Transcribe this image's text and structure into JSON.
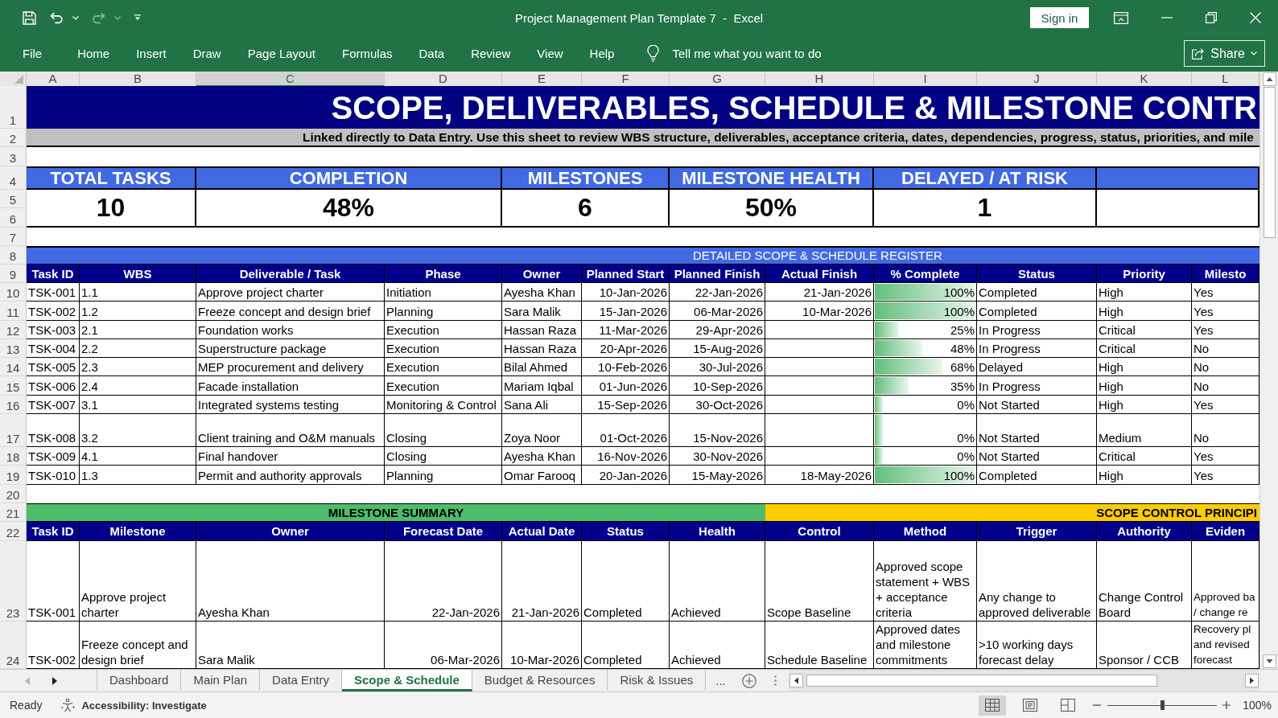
{
  "window": {
    "title": "Project Management Plan Template 7  -  Excel",
    "sign_in": "Sign in"
  },
  "quick_access": [
    {
      "kind": "save",
      "disabled": false
    },
    {
      "kind": "undo",
      "disabled": false
    },
    {
      "kind": "redo",
      "disabled": true
    },
    {
      "kind": "customize",
      "disabled": false
    }
  ],
  "ribbon": {
    "tabs": [
      "File",
      "Home",
      "Insert",
      "Draw",
      "Page Layout",
      "Formulas",
      "Data",
      "Review",
      "View",
      "Help"
    ],
    "tell_me": {
      "placeholder": "Tell me what you want to do"
    },
    "share": "Share"
  },
  "columns": [
    {
      "label": "A",
      "selected": false
    },
    {
      "label": "B",
      "selected": false
    },
    {
      "label": "C",
      "selected": true
    },
    {
      "label": "D",
      "selected": false
    },
    {
      "label": "E",
      "selected": false
    },
    {
      "label": "F",
      "selected": false
    },
    {
      "label": "G",
      "selected": false
    },
    {
      "label": "H",
      "selected": false
    },
    {
      "label": "I",
      "selected": false
    },
    {
      "label": "J",
      "selected": false
    },
    {
      "label": "K",
      "selected": false
    },
    {
      "label": "L",
      "selected": false
    }
  ],
  "row_numbers": [
    "1",
    "2",
    "3",
    "4",
    "5",
    "6",
    "7",
    "8",
    "9",
    "10",
    "11",
    "12",
    "13",
    "14",
    "15",
    "16",
    "17",
    "18",
    "19",
    "20",
    "21",
    "22",
    "23",
    "24"
  ],
  "sheet": {
    "title": "SCOPE, DELIVERABLES, SCHEDULE & MILESTONE CONTR",
    "subtitle": "Linked directly to Data Entry. Use this sheet to review WBS structure, deliverables, acceptance criteria, dates, dependencies, progress, status, priorities, and mile",
    "kpis": [
      {
        "label": "TOTAL TASKS",
        "value": "10"
      },
      {
        "label": "COMPLETION",
        "value": "48%"
      },
      {
        "label": "MILESTONES",
        "value": "6"
      },
      {
        "label": "MILESTONE HEALTH",
        "value": "50%"
      },
      {
        "label": "DELAYED / AT RISK",
        "value": "1"
      }
    ],
    "register": {
      "title": "DETAILED SCOPE & SCHEDULE REGISTER",
      "columns": [
        "Task ID",
        "WBS",
        "Deliverable / Task",
        "Phase",
        "Owner",
        "Planned Start",
        "Planned Finish",
        "Actual Finish",
        "% Complete",
        "Status",
        "Priority",
        "Milesto"
      ],
      "rows": [
        {
          "task_id": "TSK-001",
          "wbs": "1.1",
          "deliverable": "Approve project charter",
          "phase": "Initiation",
          "owner": "Ayesha Khan",
          "planned_start": "10-Jan-2026",
          "planned_finish": "22-Jan-2026",
          "actual_finish": "21-Jan-2026",
          "level": 1,
          "complete": "100%",
          "status": "Completed",
          "priority": "High",
          "column_12": "Yes"
        },
        {
          "task_id": "TSK-002",
          "wbs": "1.2",
          "deliverable": "Freeze concept and design brief",
          "phase": "Planning",
          "owner": "Sara Malik",
          "planned_start": "15-Jan-2026",
          "planned_finish": "06-Mar-2026",
          "actual_finish": "10-Mar-2026",
          "level": 1,
          "complete": "100%",
          "status": "Completed",
          "priority": "High",
          "column_12": "Yes"
        },
        {
          "task_id": "TSK-003",
          "wbs": "2.1",
          "deliverable": "Foundation works",
          "phase": "Execution",
          "owner": "Hassan Raza",
          "planned_start": "11-Mar-2026",
          "planned_finish": "29-Apr-2026",
          "level": 0.25,
          "complete": "25%",
          "status": "In Progress",
          "priority": "Critical",
          "column_12": "Yes"
        },
        {
          "task_id": "TSK-004",
          "wbs": "2.2",
          "deliverable": "Superstructure package",
          "phase": "Execution",
          "owner": "Hassan Raza",
          "planned_start": "20-Apr-2026",
          "planned_finish": "15-Aug-2026",
          "level": 0.48,
          "complete": "48%",
          "status": "In Progress",
          "priority": "Critical",
          "column_12": "No"
        },
        {
          "task_id": "TSK-005",
          "wbs": "2.3",
          "deliverable": "MEP procurement and delivery",
          "phase": "Execution",
          "owner": "Bilal Ahmed",
          "planned_start": "10-Feb-2026",
          "planned_finish": "30-Jul-2026",
          "level": 0.68,
          "complete": "68%",
          "status": "Delayed",
          "priority": "High",
          "column_12": "No"
        },
        {
          "task_id": "TSK-006",
          "wbs": "2.4",
          "deliverable": "Facade installation",
          "phase": "Execution",
          "owner": "Mariam Iqbal",
          "planned_start": "01-Jun-2026",
          "planned_finish": "10-Sep-2026",
          "level": 0.35,
          "complete": "35%",
          "status": "In Progress",
          "priority": "High",
          "column_12": "No"
        },
        {
          "task_id": "TSK-007",
          "wbs": "3.1",
          "deliverable": "Integrated systems testing",
          "phase": "Monitoring & Control",
          "owner": "Sana Ali",
          "planned_start": "15-Sep-2026",
          "planned_finish": "30-Oct-2026",
          "level": 0,
          "complete": "0%",
          "status": "Not Started",
          "priority": "High",
          "column_12": "Yes"
        },
        {
          "task_id": "TSK-008",
          "wbs": "3.2",
          "deliverable": "Client training and O&M manuals",
          "phase": "Closing",
          "owner": "Zoya Noor",
          "planned_start": "01-Oct-2026",
          "planned_finish": "15-Nov-2026",
          "level": 0,
          "complete": "0%",
          "status": "Not Started",
          "priority": "Medium",
          "column_12": "No"
        },
        {
          "task_id": "TSK-009",
          "wbs": "4.1",
          "deliverable": "Final handover",
          "phase": "Closing",
          "owner": "Ayesha Khan",
          "planned_start": "16-Nov-2026",
          "planned_finish": "30-Nov-2026",
          "level": 0,
          "complete": "0%",
          "status": "Not Started",
          "priority": "Critical",
          "column_12": "Yes"
        },
        {
          "task_id": "TSK-010",
          "wbs": "1.3",
          "deliverable": "Permit and authority approvals",
          "phase": "Planning",
          "owner": "Omar Farooq",
          "planned_start": "20-Jan-2026",
          "planned_finish": "15-May-2026",
          "actual_finish": "18-May-2026",
          "level": 1,
          "complete": "100%",
          "status": "Completed",
          "priority": "High",
          "column_12": "Yes"
        }
      ]
    },
    "milestone_summary": {
      "title": "MILESTONE SUMMARY",
      "columns": [
        "Task ID",
        "Milestone",
        "Owner",
        "Forecast Date",
        "Actual Date",
        "Status",
        "Health"
      ],
      "rows": [
        {
          "task_id": "TSK-001",
          "milestone": "Approve project charter",
          "owner": "Ayesha Khan",
          "forecast_date": "22-Jan-2026",
          "actual_date": "21-Jan-2026",
          "status": "Completed",
          "health": "Achieved"
        },
        {
          "task_id": "TSK-002",
          "milestone": "Freeze concept and design brief",
          "owner": "Sara Malik",
          "forecast_date": "06-Mar-2026",
          "actual_date": "10-Mar-2026",
          "status": "Completed",
          "health": "Achieved"
        }
      ]
    },
    "scope_control": {
      "title": "SCOPE CONTROL PRINCIPI",
      "columns": [
        "Control",
        "Method",
        "Trigger",
        "Authority",
        "Eviden"
      ],
      "rows": [
        {
          "control": "Scope Baseline",
          "method": "Approved scope statement + WBS + acceptance criteria",
          "trigger": "Any change to approved deliverable",
          "authority": "Change Control Board",
          "column_5": "Approved ba / change re"
        },
        {
          "control": "Schedule Baseline",
          "method": "Approved dates and milestone commitments",
          "trigger": ">10 working days forecast delay",
          "authority": "Sponsor / CCB",
          "column_5": "Recovery pl and revised forecast"
        }
      ]
    }
  },
  "sheet_tabs": {
    "nav": [
      {
        "kind": "prev",
        "disabled": true
      },
      {
        "kind": "next",
        "disabled": false
      }
    ],
    "tabs": [
      {
        "label": "Dashboard",
        "selected": false
      },
      {
        "label": "Main Plan",
        "selected": false
      },
      {
        "label": "Data Entry",
        "selected": false
      },
      {
        "label": "Scope & Schedule",
        "selected": true
      },
      {
        "label": "Budget & Resources",
        "selected": false
      },
      {
        "label": "Risk & Issues",
        "selected": false
      }
    ],
    "more": "..."
  },
  "status_bar": {
    "status": "Ready",
    "accessibility": "Accessibility: Investigate",
    "views": [
      {
        "kind": "normal",
        "selected": true
      },
      {
        "kind": "page_layout",
        "selected": false
      },
      {
        "kind": "page_break",
        "selected": false
      }
    ],
    "zoom": {
      "level": 0.5,
      "reading": "100%"
    }
  }
}
